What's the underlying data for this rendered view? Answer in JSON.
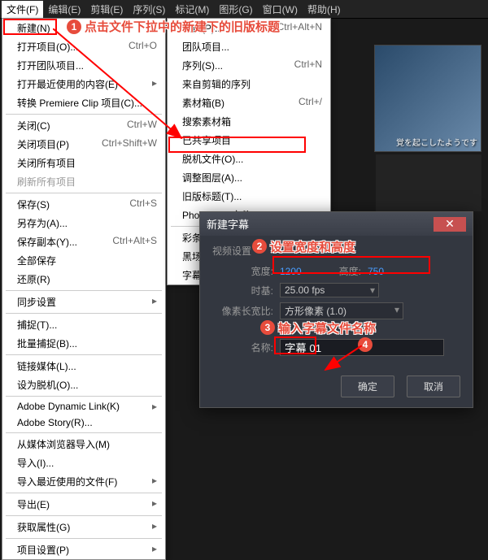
{
  "menubar": {
    "items": [
      "文件(F)",
      "编辑(E)",
      "剪辑(E)",
      "序列(S)",
      "标记(M)",
      "图形(G)",
      "窗口(W)",
      "帮助(H)"
    ]
  },
  "dd1": [
    {
      "t": "新建(N)",
      "arrow": true,
      "hl": true
    },
    {
      "t": "打开项目(O)...",
      "sc": "Ctrl+O"
    },
    {
      "t": "打开团队项目..."
    },
    {
      "t": "打开最近使用的内容(E)",
      "arrow": true
    },
    {
      "t": "转换 Premiere Clip 项目(C)..."
    },
    {
      "sep": true
    },
    {
      "t": "关闭(C)",
      "sc": "Ctrl+W"
    },
    {
      "t": "关闭项目(P)",
      "sc": "Ctrl+Shift+W"
    },
    {
      "t": "关闭所有项目"
    },
    {
      "t": "刷新所有项目",
      "disabled": true
    },
    {
      "sep": true
    },
    {
      "t": "保存(S)",
      "sc": "Ctrl+S"
    },
    {
      "t": "另存为(A)..."
    },
    {
      "t": "保存副本(Y)...",
      "sc": "Ctrl+Alt+S"
    },
    {
      "t": "全部保存"
    },
    {
      "t": "还原(R)"
    },
    {
      "sep": true
    },
    {
      "t": "同步设置",
      "arrow": true
    },
    {
      "sep": true
    },
    {
      "t": "捕捉(T)..."
    },
    {
      "t": "批量捕捉(B)..."
    },
    {
      "sep": true
    },
    {
      "t": "链接媒体(L)..."
    },
    {
      "t": "设为脱机(O)..."
    },
    {
      "sep": true
    },
    {
      "t": "Adobe Dynamic Link(K)",
      "arrow": true
    },
    {
      "t": "Adobe Story(R)..."
    },
    {
      "sep": true
    },
    {
      "t": "从媒体浏览器导入(M)"
    },
    {
      "t": "导入(I)..."
    },
    {
      "t": "导入最近使用的文件(F)",
      "arrow": true
    },
    {
      "sep": true
    },
    {
      "t": "导出(E)",
      "arrow": true
    },
    {
      "sep": true
    },
    {
      "t": "获取属性(G)",
      "arrow": true
    },
    {
      "sep": true
    },
    {
      "t": "项目设置(P)",
      "arrow": true
    }
  ],
  "dd2": [
    {
      "t": "项目(P)...",
      "sc": "Ctrl+Alt+N"
    },
    {
      "t": "团队项目..."
    },
    {
      "t": "序列(S)...",
      "sc": "Ctrl+N"
    },
    {
      "t": "来自剪辑的序列"
    },
    {
      "t": "素材箱(B)",
      "sc": "Ctrl+/"
    },
    {
      "t": "搜索素材箱"
    },
    {
      "t": "已共享项目"
    },
    {
      "t": "脱机文件(O)..."
    },
    {
      "t": "调整图层(A)..."
    },
    {
      "t": "旧版标题(T)...",
      "hl": true
    },
    {
      "t": "Photoshop 文件(H)..."
    },
    {
      "sep": true
    },
    {
      "t": "彩条..."
    },
    {
      "t": "黑场视频..."
    },
    {
      "t": "字幕..."
    }
  ],
  "dlg": {
    "title": "新建字幕",
    "section": "视频设置",
    "width_lbl": "宽度:",
    "width": "1200",
    "height_lbl": "高度:",
    "height": "750",
    "base_lbl": "时基:",
    "base": "25.00 fps",
    "aspect_lbl": "像素长宽比:",
    "aspect": "方形像素 (1.0)",
    "name_lbl": "名称:",
    "name": "字幕 01",
    "ok": "确定",
    "cancel": "取消"
  },
  "anno": {
    "a1": "点击文件下拉中的新建下的旧版标题",
    "a2": "设置宽度和高度",
    "a3": "输入字幕文件名称"
  },
  "thumb": "覚を起こしたようです"
}
